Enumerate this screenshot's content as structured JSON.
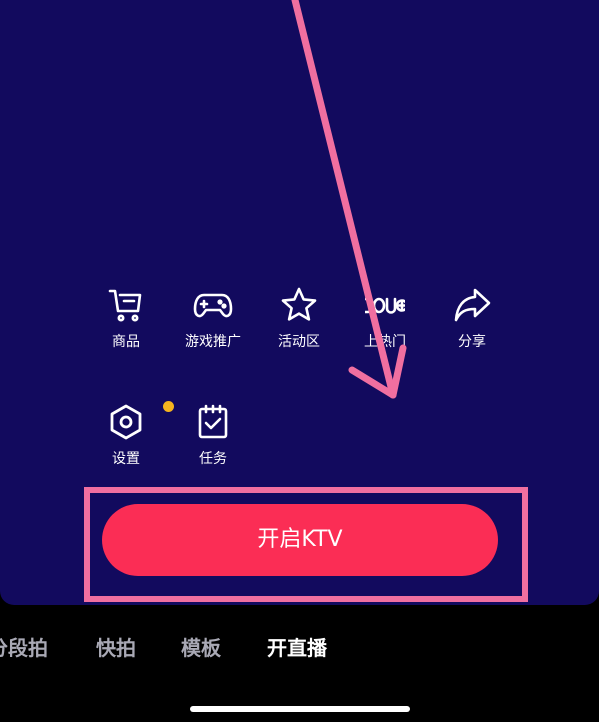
{
  "tools": [
    {
      "label": "商品",
      "icon": "cart-icon"
    },
    {
      "label": "游戏推广",
      "icon": "gamepad-icon"
    },
    {
      "label": "活动区",
      "icon": "star-icon"
    },
    {
      "label": "上热门",
      "icon": "dou-plus-icon"
    },
    {
      "label": "分享",
      "icon": "share-icon"
    },
    {
      "label": "设置",
      "icon": "settings-icon",
      "badge": "dot"
    },
    {
      "label": "任务",
      "icon": "task-icon"
    }
  ],
  "cta": {
    "label": "开启KTV"
  },
  "modes": [
    {
      "label": "分段拍",
      "active": false
    },
    {
      "label": "快拍",
      "active": false
    },
    {
      "label": "模板",
      "active": false
    },
    {
      "label": "开直播",
      "active": true
    }
  ],
  "colors": {
    "panel_bg": "#120a5e",
    "cta_bg": "#fb2d55",
    "annotation": "#f06fa0",
    "badge": "#f5b41e"
  }
}
